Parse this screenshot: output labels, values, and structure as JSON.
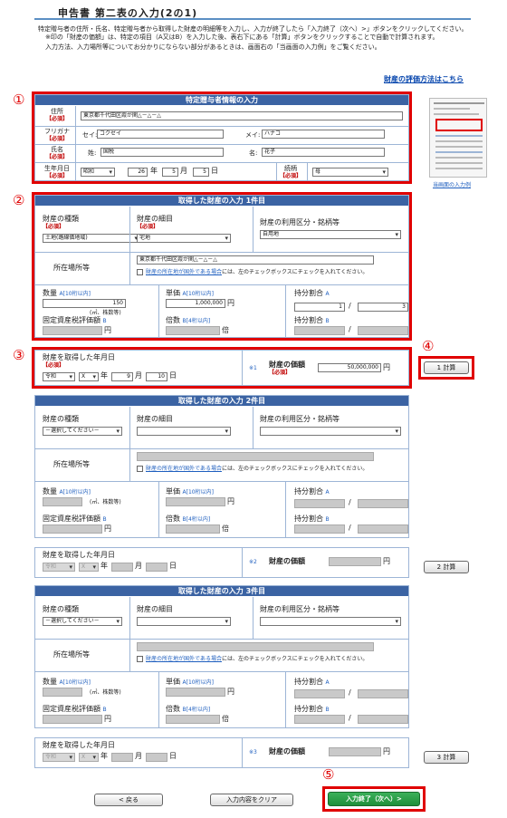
{
  "page": {
    "title": "申告書 第二表の入力(2の1)",
    "instr1": "特定贈与者の住所・氏名、特定贈与者から取得した財産の明細等を入力し、入力が終了したら「入力終了（次へ）>」ボタンをクリックしてください。",
    "instr2": "※印の「財産の価額」は、特定の項目（A又はB）を入力した後、表右下にある「計算」ボタンをクリックすることで自動で計算されます。",
    "instr3": "入力方法、入力場所等についてお分かりにならない部分があるときは、画面右の「当画面の入力例」をご覧ください。",
    "eval_link": "財産の評価方法はこちら",
    "example_link": "当画面の入力例"
  },
  "labels": {
    "required": "【必須】",
    "address": "住所",
    "furigana": "フリガナ",
    "name": "氏名",
    "birth": "生年月日",
    "relation": "続柄",
    "sei_k": "セイ:",
    "mei_k": "メイ:",
    "sei": "姓:",
    "mei": "名:",
    "year": "年",
    "month": "月",
    "day": "日",
    "kind": "財産の種類",
    "detail": "財産の細目",
    "use": "財産の利用区分・銘柄等",
    "location": "所在場所等",
    "overseas_link": "財産の所在地が国外である場合",
    "overseas_text": "には、左のチェックボックスにチェックを入れてください。",
    "qty": "数量",
    "a10": "A[10桁以内]",
    "unit": "単価",
    "b4": "B[4桁以内]",
    "share": "持分割合",
    "share_a": "A",
    "share_b": "B",
    "fixed_tax": "固定資産税評価額",
    "fixed_b": "B",
    "multiplier": "倍数",
    "m2": "(㎡、株数等)",
    "yen": "円",
    "bai": "倍",
    "acq_date": "財産を取得した年月日",
    "value": "財産の価額",
    "mark1": "※1",
    "mark2": "※2",
    "mark3": "※3"
  },
  "donor": {
    "header": "特定贈与者情報の入力",
    "address": "東京都千代田区霞が関△－△－△",
    "sei_kana": "コクゼイ",
    "mei_kana": "ハナコ",
    "sei": "国税",
    "mei": "花子",
    "era": "昭和",
    "year": "26",
    "month": "5",
    "day": "5",
    "relation": "母"
  },
  "p1": {
    "header": "取得した財産の入力 1件目",
    "kind": "土地(路線価地域)",
    "detail": "宅地",
    "use": "自用地",
    "location": "東京都千代田区霞が関△－△－△",
    "qty": "150",
    "unit": "1,000,000",
    "share_num": "1",
    "share_den": "3",
    "era": "令和",
    "year": "X",
    "month": "9",
    "day": "10",
    "value": "50,000,000",
    "calc": "1 計算"
  },
  "p2": {
    "header": "取得した財産の入力 2件目",
    "kind": "－選択してください－",
    "era": "令和",
    "year": "X",
    "calc": "2 計算"
  },
  "p3": {
    "header": "取得した財産の入力 3件目",
    "kind": "－選択してください－",
    "era": "令和",
    "year": "X",
    "calc": "3 計算"
  },
  "buttons": {
    "back": "< 戻る",
    "clear": "入力内容をクリア",
    "next": "入力終了（次へ）>"
  },
  "markers": {
    "m1": "①",
    "m2": "②",
    "m3": "③",
    "m4": "④",
    "m5": "⑤"
  },
  "colors": {
    "header": "#3b63a3",
    "callout": "#e00000",
    "next_button": "#1f8f3a"
  }
}
